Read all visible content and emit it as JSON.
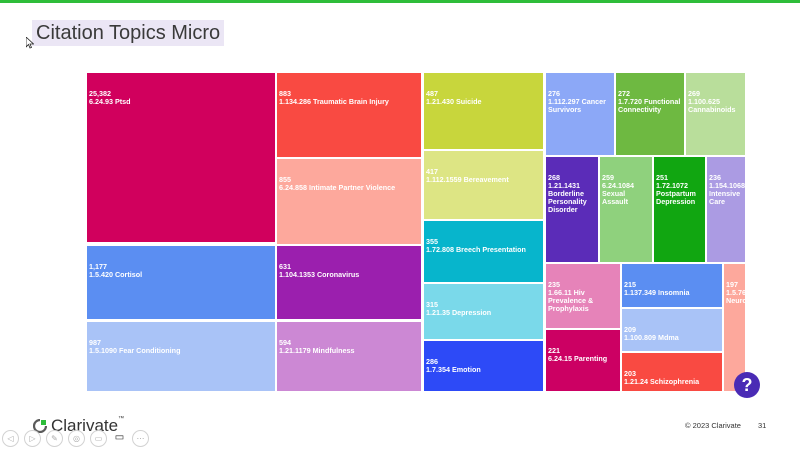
{
  "slide": {
    "title": "Citation Topics Micro",
    "copyright": "© 2023 Clarivate",
    "page_number": "31",
    "logo_text": "Clarivate",
    "logo_tm": "™",
    "help_label": "?"
  },
  "colors": {
    "accent_line": "#2ebd3a",
    "title_highlight": "#ebe6f5",
    "help_button": "#4a2bb5"
  },
  "chart_data": {
    "type": "treemap",
    "title": "",
    "items": [
      {
        "value": "25,382",
        "label": "6.24.93 Ptsd",
        "color": "#d1005d"
      },
      {
        "value": "1,177",
        "label": "1.5.420 Cortisol",
        "color": "#5b8ef2"
      },
      {
        "value": "987",
        "label": "1.5.1090 Fear Conditioning",
        "color": "#a9c3f7"
      },
      {
        "value": "883",
        "label": "1.134.286 Traumatic Brain Injury",
        "color": "#f94a42"
      },
      {
        "value": "855",
        "label": "6.24.858 Intimate Partner Violence",
        "color": "#fda89c"
      },
      {
        "value": "631",
        "label": "1.104.1353 Coronavirus",
        "color": "#9b1fae"
      },
      {
        "value": "594",
        "label": "1.21.1179 Mindfulness",
        "color": "#cc88d4"
      },
      {
        "value": "487",
        "label": "1.21.430 Suicide",
        "color": "#c8d63c"
      },
      {
        "value": "417",
        "label": "1.112.1559 Bereavement",
        "color": "#dde584"
      },
      {
        "value": "355",
        "label": "1.72.808 Breech Presentation",
        "color": "#07b5cc"
      },
      {
        "value": "315",
        "label": "1.21.35 Depression",
        "color": "#7ad9ea"
      },
      {
        "value": "286",
        "label": "1.7.354 Emotion",
        "color": "#2d4af7"
      },
      {
        "value": "276",
        "label": "1.112.297 Cancer Survivors",
        "color": "#8ca8f7"
      },
      {
        "value": "272",
        "label": "1.7.720 Functional Connectivity",
        "color": "#6eb941"
      },
      {
        "value": "269",
        "label": "1.100.625 Cannabinoids",
        "color": "#b9de9b"
      },
      {
        "value": "268",
        "label": "1.21.1431 Borderline Personality Disorder",
        "color": "#5b2cb8"
      },
      {
        "value": "259",
        "label": "6.24.1084 Sexual Assault",
        "color": "#8fd17d"
      },
      {
        "value": "251",
        "label": "1.72.1072 Postpartum Depression",
        "color": "#11a611"
      },
      {
        "value": "236",
        "label": "1.154.1068 Intensive Care",
        "color": "#ab9be3"
      },
      {
        "value": "235",
        "label": "1.66.11 Hiv Prevalence & Prophylaxis",
        "color": "#e683b9"
      },
      {
        "value": "221",
        "label": "6.24.15 Parenting",
        "color": "#cc0063"
      },
      {
        "value": "215",
        "label": "1.137.349 Insomnia",
        "color": "#5b8ef2"
      },
      {
        "value": "209",
        "label": "1.100.809 Mdma",
        "color": "#a9c3f7"
      },
      {
        "value": "203",
        "label": "1.21.24 Schizophrenia",
        "color": "#f94a42"
      },
      {
        "value": "197",
        "label": "1.5.76 Neuro",
        "color": "#fda89c"
      }
    ]
  },
  "controls": [
    "◁",
    "▷",
    "✎",
    "◎",
    "▭",
    "▭",
    "⋯"
  ]
}
